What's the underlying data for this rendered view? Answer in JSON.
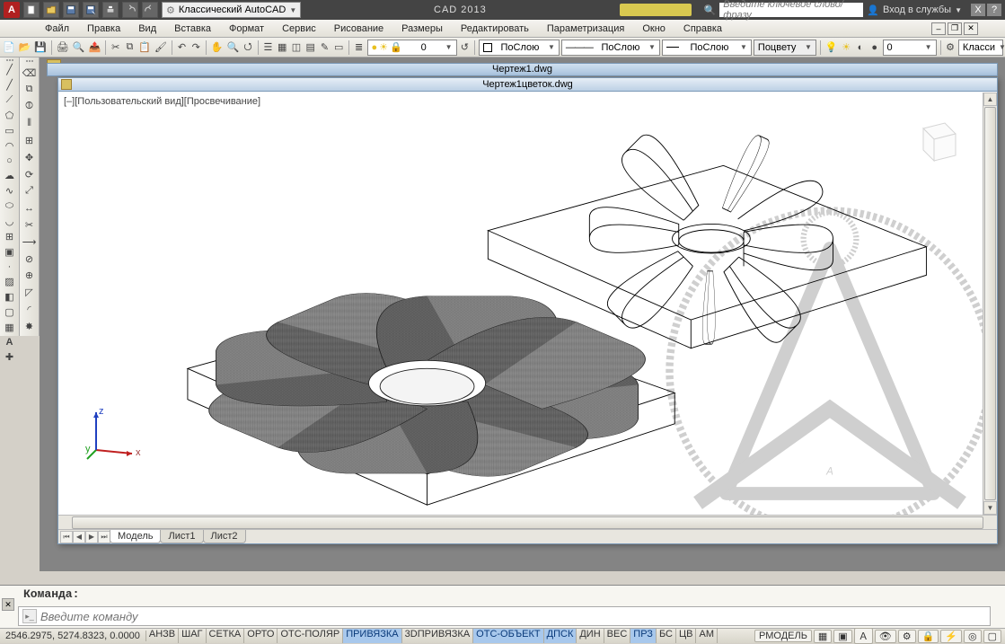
{
  "title_app": "CAD 2013",
  "workspace": "Классический AutoCAD",
  "search_placeholder": "Введите ключевое слово/фразу",
  "login_label": "Вход в службы",
  "menu": [
    "Файл",
    "Правка",
    "Вид",
    "Вставка",
    "Формат",
    "Сервис",
    "Рисование",
    "Размеры",
    "Редактировать",
    "Параметризация",
    "Окно",
    "Справка"
  ],
  "toolbar": {
    "layer_value": "0",
    "color_value": "ПоСлою",
    "ltype_value": "ПоСлою",
    "lweight_value": "ПоСлою",
    "plotstyle_value": "Поцвету",
    "ws_value": "Класси"
  },
  "doc1_title": "Чертеж1.dwg",
  "doc2_title": "Чертеж1цветок.dwg",
  "view_label": "[–][Пользовательский вид][Просвечивание]",
  "sheets": {
    "model": "Модель",
    "s1": "Лист1",
    "s2": "Лист2"
  },
  "command": {
    "history": "Команда:",
    "placeholder": "Введите команду"
  },
  "status": {
    "coords": "2546.2975, 5274.8323, 0.0000",
    "toggles": [
      {
        "label": "АНЗВ",
        "on": false
      },
      {
        "label": "ШАГ",
        "on": false
      },
      {
        "label": "СЕТКА",
        "on": false
      },
      {
        "label": "ОРТО",
        "on": false
      },
      {
        "label": "ОТС-ПОЛЯР",
        "on": false
      },
      {
        "label": "ПРИВЯЗКА",
        "on": true
      },
      {
        "label": "3DПРИВЯЗКА",
        "on": false
      },
      {
        "label": "ОТС-ОБЪЕКТ",
        "on": true
      },
      {
        "label": "ДПСК",
        "on": true
      },
      {
        "label": "ДИН",
        "on": false
      },
      {
        "label": "ВЕС",
        "on": false
      },
      {
        "label": "ПРЗ",
        "on": true
      },
      {
        "label": "БС",
        "on": false
      },
      {
        "label": "ЦВ",
        "on": false
      },
      {
        "label": "АМ",
        "on": false
      }
    ],
    "right_label": "РМОДЕЛЬ"
  }
}
